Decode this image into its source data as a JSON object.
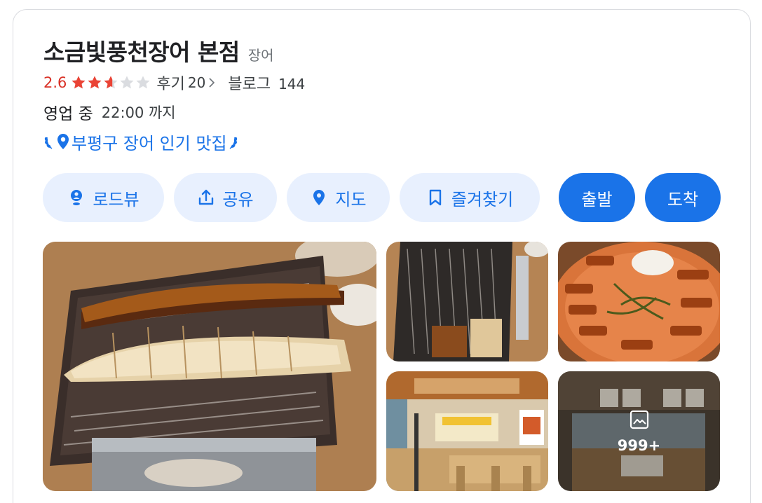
{
  "place": {
    "name": "소금빛풍천장어 본점",
    "category": "장어"
  },
  "rating": {
    "score": "2.6",
    "stars_value": 2.6,
    "stars_max": 5,
    "reviews_label": "후기",
    "reviews_count": "20",
    "blog_label": "블로그",
    "blog_count": "144"
  },
  "hours": {
    "status": "영업 중",
    "closing": "22:00 까지"
  },
  "badge": {
    "text": "부평구 장어 인기 맛집"
  },
  "actions": [
    {
      "label": "로드뷰",
      "icon": "person-pin-icon"
    },
    {
      "label": "공유",
      "icon": "share-upload-icon"
    },
    {
      "label": "지도",
      "icon": "map-pin-icon"
    },
    {
      "label": "즐겨찾기",
      "icon": "bookmark-icon"
    },
    {
      "label": "출발",
      "icon": ""
    },
    {
      "label": "도착",
      "icon": ""
    }
  ],
  "photos": {
    "more_count": "999+",
    "more_icon": "image-gallery-icon"
  },
  "colors": {
    "accent": "#1a73e8",
    "accent_light": "#e8f0fe",
    "rating_red": "#d93025",
    "star_red": "#ea4335",
    "star_empty": "#dadce0"
  }
}
